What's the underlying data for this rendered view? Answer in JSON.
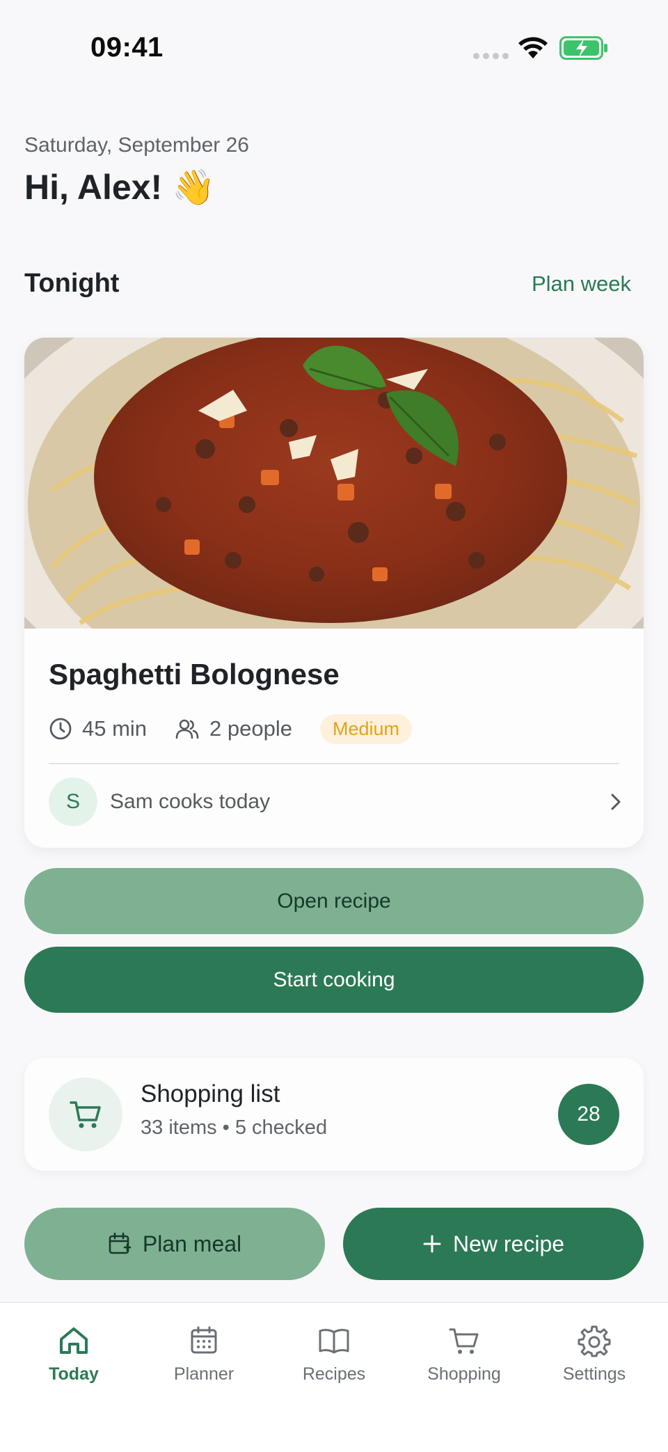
{
  "status_bar": {
    "time": "09:41"
  },
  "header": {
    "date": "Saturday, September 26",
    "greeting": "Hi, Alex! 👋"
  },
  "tonight": {
    "section_title": "Tonight",
    "plan_week_label": "Plan week",
    "recipe": {
      "title": "Spaghetti Bolognese",
      "time": "45 min",
      "servings": "2 people",
      "difficulty": "Medium",
      "cook_initial": "S",
      "cook_text": "Sam cooks today"
    }
  },
  "actions": {
    "open_recipe": "Open recipe",
    "start_cooking": "Start cooking",
    "plan_meal": "Plan meal",
    "new_recipe": "New recipe"
  },
  "shopping": {
    "title": "Shopping list",
    "subtitle": "33 items • 5 checked",
    "count": "28"
  },
  "tabs": [
    {
      "label": "Today",
      "icon": "home-icon",
      "active": true
    },
    {
      "label": "Planner",
      "icon": "calendar-icon",
      "active": false
    },
    {
      "label": "Recipes",
      "icon": "book-icon",
      "active": false
    },
    {
      "label": "Shopping",
      "icon": "cart-icon",
      "active": false
    },
    {
      "label": "Settings",
      "icon": "gear-icon",
      "active": false
    }
  ],
  "colors": {
    "brand_green": "#2b7a55",
    "light_green": "#7eb191",
    "badge_bg": "#fdf1dc",
    "badge_text": "#e3a21a",
    "background": "#f8f8fa"
  }
}
